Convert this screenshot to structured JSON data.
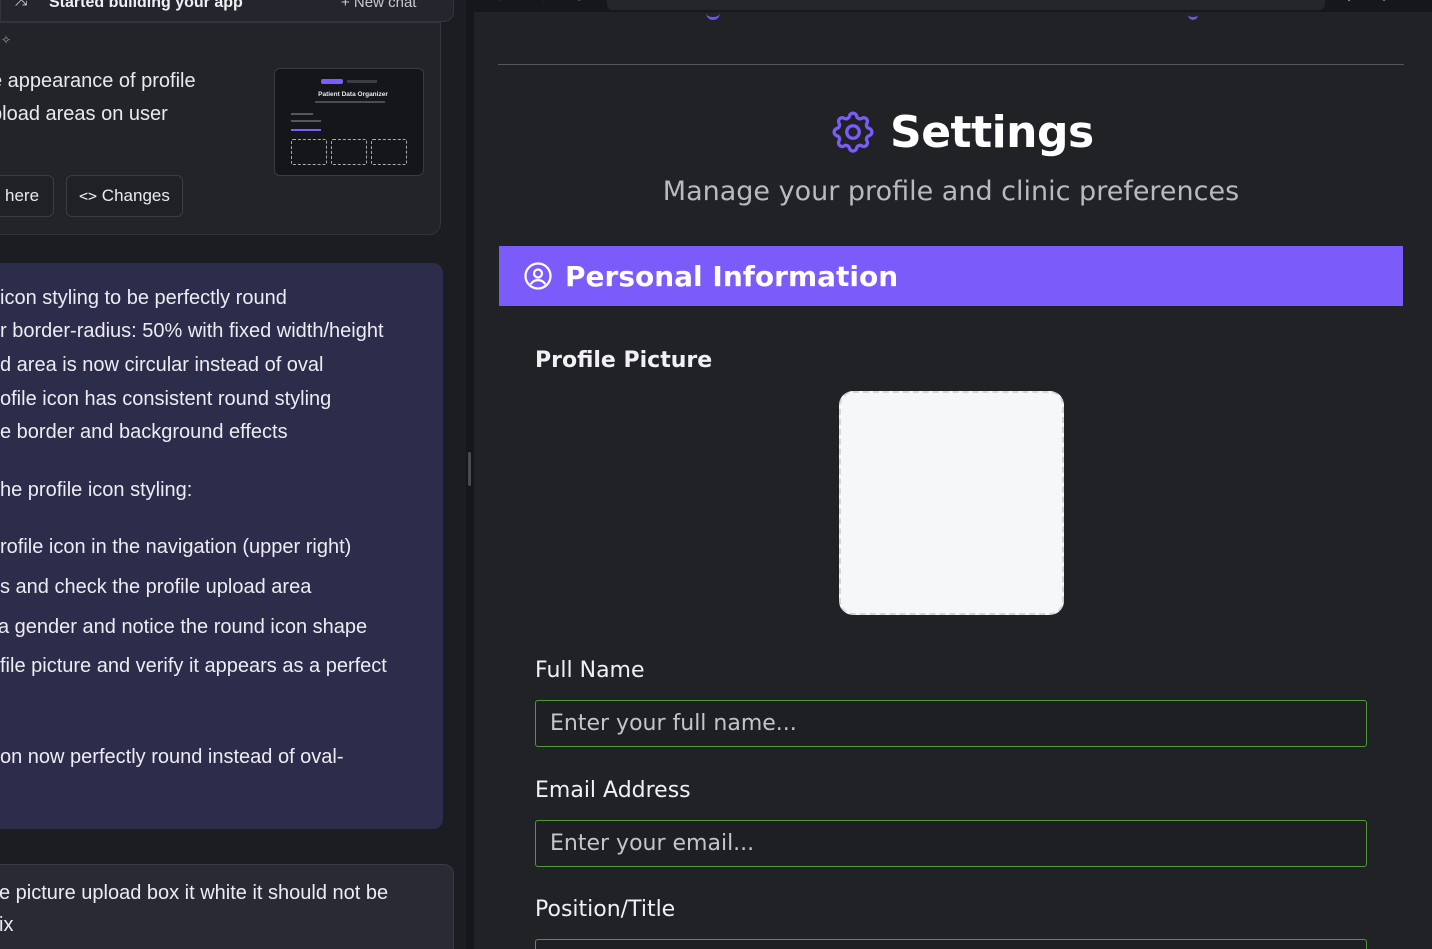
{
  "chat": {
    "header_title": "Started building your app",
    "new_chat_label": "+ New chat",
    "summary_lines": [
      "e appearance of profile",
      "pload areas on user"
    ],
    "thumbnail_title": "Patient Data Organizer",
    "buttons": {
      "preview_here": "here",
      "changes": "Changes"
    },
    "reply_lines": [
      "icon styling to be perfectly round",
      "r border-radius: 50% with fixed width/height",
      "d area is now circular instead of oval",
      "ofile icon has consistent round styling",
      "e border and background effects",
      "he profile icon styling:",
      "rofile icon in the navigation (upper right)",
      "s and check the profile upload area",
      " a gender and notice the round icon shape",
      "file picture and verify it appears as a perfect",
      "on now perfectly round instead of oval-"
    ],
    "user_lines": [
      "e picture upload box it white it should not be",
      "ix"
    ]
  },
  "preview": {
    "page_title": "Settings",
    "subtitle": "Manage your profile and clinic preferences",
    "section_title": "Personal Information",
    "profile_picture_label": "Profile Picture",
    "full_name_label": "Full Name",
    "full_name_placeholder": "Enter your full name...",
    "email_label": "Email Address",
    "email_placeholder": "Enter your email...",
    "position_label": "Position/Title"
  },
  "colors": {
    "accent": "#7b5cfa",
    "field_border": "#4e9a3a",
    "chat_bubble": "#2c2c4b",
    "upload_bg": "#f6f7f9"
  },
  "icons": [
    "shuffle-icon",
    "sparkle-icon",
    "code-icon",
    "gear-icon",
    "user-circle-icon"
  ]
}
